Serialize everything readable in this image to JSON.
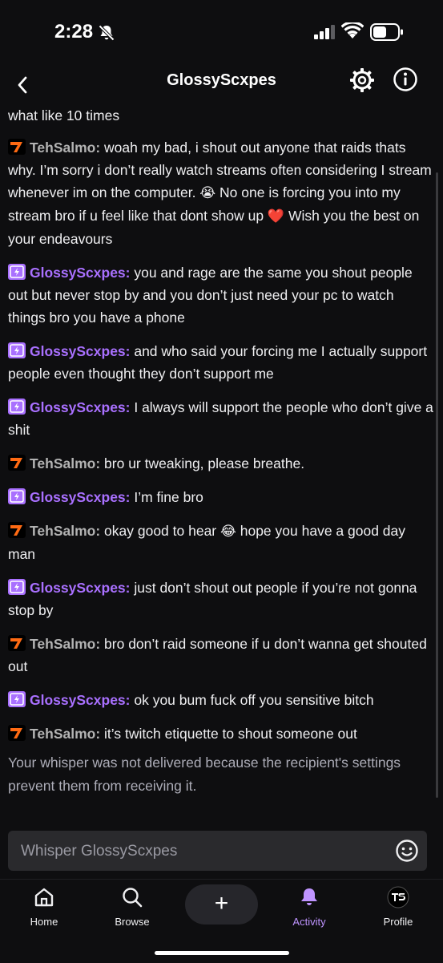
{
  "status_bar": {
    "time": "2:28"
  },
  "header": {
    "title": "GlossyScxpes"
  },
  "messages": {
    "m0": {
      "text": "what like 10 times"
    },
    "m1": {
      "user": "TehSalmo:",
      "text_a": " woah my bad, i shout out anyone that raids thats why. I’m sorry i don’t really watch streams often considering I stream whenever im on the computer. ",
      "emoji_a": "😭",
      "text_b": " No one is forcing you into my stream bro if u feel like that dont show up ",
      "emoji_b": "❤️",
      "text_c": " Wish you the best on your endeavours"
    },
    "m2": {
      "user": "GlossyScxpes:",
      "text": " you and rage are the same you shout people out but never stop by and you don’t just need your pc to watch things bro you have a phone"
    },
    "m3": {
      "user": "GlossyScxpes:",
      "text": " and who said your forcing me I actually support people even thought they don’t support me"
    },
    "m4": {
      "user": "GlossyScxpes:",
      "text": " I always will support the people who don’t give a shit"
    },
    "m5": {
      "user": "TehSalmo:",
      "text": " bro ur tweaking, please breathe."
    },
    "m6": {
      "user": "GlossyScxpes:",
      "text": " I’m fine bro"
    },
    "m7": {
      "user": "TehSalmo:",
      "text_a": " okay good to hear ",
      "emoji": "😂",
      "text_b": " hope you have a good day man"
    },
    "m8": {
      "user": "GlossyScxpes:",
      "text": " just don’t shout out people if you’re not gonna stop by"
    },
    "m9": {
      "user": "TehSalmo:",
      "text": " bro don’t raid someone if u don’t wanna get shouted out"
    },
    "m10": {
      "user": "GlossyScxpes:",
      "text": " ok you bum fuck off you sensitive bitch"
    },
    "m11": {
      "user": "TehSalmo:",
      "text": " it’s twitch etiquette to shout someone out"
    },
    "system": "Your whisper was not delivered because the recipient's settings prevent them from receiving it."
  },
  "composer": {
    "placeholder": "Whisper GlossyScxpes"
  },
  "nav": {
    "home": "Home",
    "browse": "Browse",
    "plus": "+",
    "activity": "Activity",
    "profile": "Profile"
  },
  "colors": {
    "accent": "#a970ff",
    "active_nav": "#bf94ff",
    "background": "#0e0e10"
  },
  "icons": [
    "bell-slash-icon",
    "signal-icon",
    "wifi-icon",
    "battery-icon",
    "back-icon",
    "gear-icon",
    "info-icon",
    "emoji-icon",
    "home-icon",
    "search-icon",
    "plus-icon",
    "bell-icon",
    "profile-avatar-icon"
  ]
}
